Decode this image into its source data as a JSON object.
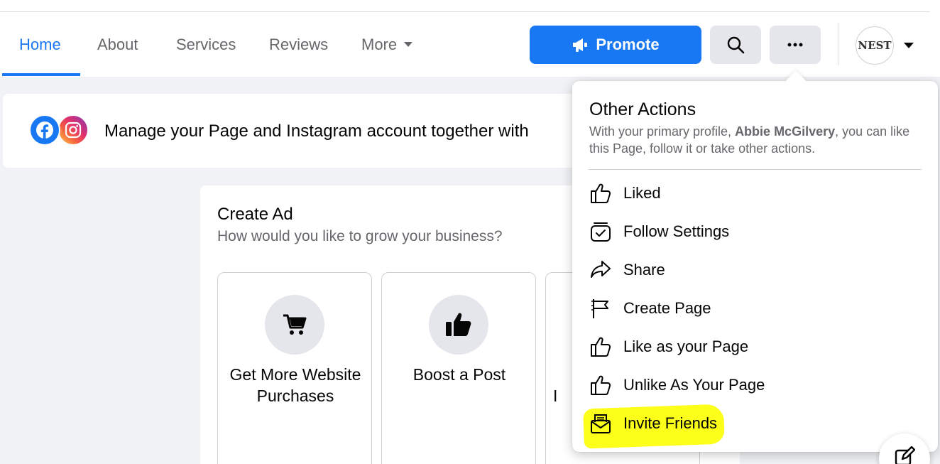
{
  "nav": {
    "tabs": [
      {
        "label": "Home",
        "active": true
      },
      {
        "label": "About"
      },
      {
        "label": "Services"
      },
      {
        "label": "Reviews"
      },
      {
        "label": "More"
      }
    ],
    "promote_label": "Promote",
    "avatar_text": "NEST"
  },
  "banner": {
    "text": "Manage your Page and Instagram account together with"
  },
  "create_ad": {
    "title": "Create Ad",
    "subtitle": "How would you like to grow your business?",
    "tiles": [
      {
        "label": "Get More Website Purchases",
        "icon": "cart-icon"
      },
      {
        "label": "Boost a Post",
        "icon": "thumbs-up-icon"
      },
      {
        "label": "I",
        "icon": ""
      }
    ]
  },
  "dropdown": {
    "title": "Other Actions",
    "desc_prefix": "With your primary profile, ",
    "desc_name": "Abbie McGilvery",
    "desc_suffix": ", you can like this Page, follow it or take other actions.",
    "items": [
      {
        "label": "Liked",
        "icon": "like-icon"
      },
      {
        "label": "Follow Settings",
        "icon": "follow-settings-icon"
      },
      {
        "label": "Share",
        "icon": "share-icon"
      },
      {
        "label": "Create Page",
        "icon": "flag-icon"
      },
      {
        "label": "Like as your Page",
        "icon": "like-icon"
      },
      {
        "label": "Unlike As Your Page",
        "icon": "like-icon"
      },
      {
        "label": "Invite Friends",
        "icon": "envelope-icon"
      }
    ]
  },
  "colors": {
    "accent": "#1877f2",
    "highlight": "#fbff1a",
    "secondary_text": "#65676b"
  }
}
